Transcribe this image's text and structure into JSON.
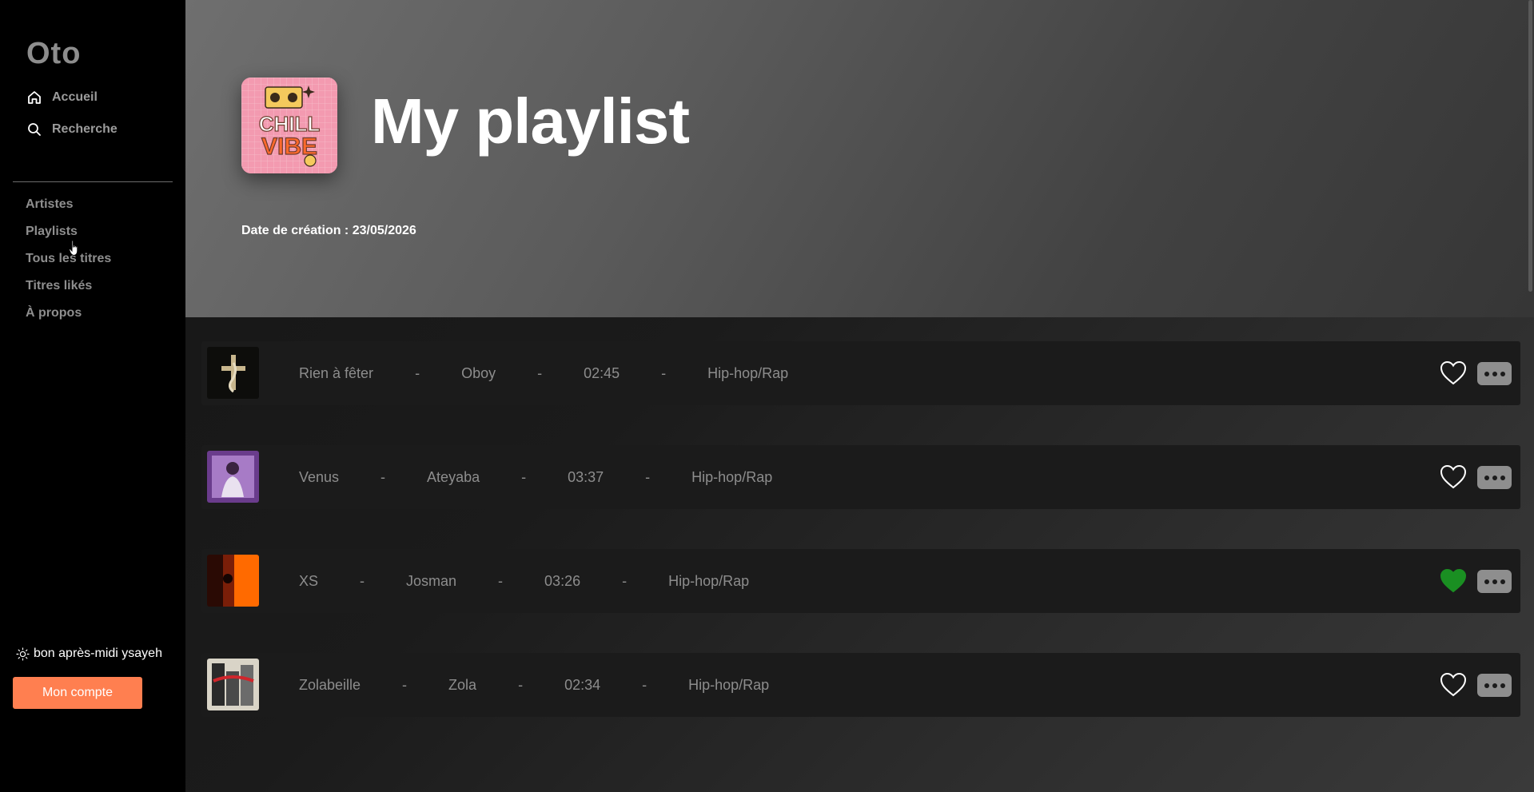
{
  "app": {
    "logo": "Oto"
  },
  "nav_main": [
    {
      "label": "Accueil",
      "icon": "home-icon"
    },
    {
      "label": "Recherche",
      "icon": "search-icon"
    }
  ],
  "nav_secondary": [
    "Artistes",
    "Playlists",
    "Tous les titres",
    "Titres likés",
    "À propos"
  ],
  "greeting": {
    "icon": "sun-icon",
    "text": "bon après-midi ysayeh"
  },
  "account_button": "Mon compte",
  "playlist": {
    "title": "My playlist",
    "creation_date": "Date de création : 23/05/2026",
    "cover_text_top": "CHILL",
    "cover_text_bottom": "VIBE"
  },
  "separator": "-",
  "tracks": [
    {
      "title": "Rien à fêter",
      "artist": "Oboy",
      "duration": "02:45",
      "genre": "Hip-hop/Rap",
      "liked": false
    },
    {
      "title": "Venus",
      "artist": "Ateyaba",
      "duration": "03:37",
      "genre": "Hip-hop/Rap",
      "liked": false
    },
    {
      "title": "XS",
      "artist": "Josman",
      "duration": "03:26",
      "genre": "Hip-hop/Rap",
      "liked": true
    },
    {
      "title": "Zolabeille",
      "artist": "Zola",
      "duration": "02:34",
      "genre": "Hip-hop/Rap",
      "liked": false
    }
  ],
  "colors": {
    "accent": "#ff7f50",
    "liked": "#1a8f22"
  }
}
